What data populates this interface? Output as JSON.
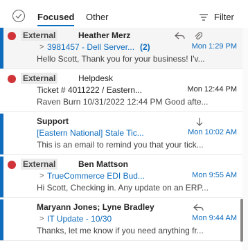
{
  "header": {
    "tabs": [
      {
        "label": "Focused",
        "active": true
      },
      {
        "label": "Other",
        "active": false
      }
    ],
    "filter_label": "Filter"
  },
  "colors": {
    "accent": "#0f6cbd",
    "external_dot": "#d13438"
  },
  "messages": [
    {
      "external_tag": "External",
      "sender": "Heather Merz",
      "subject": "3981457 - Dell Server...",
      "thread_count": "(2)",
      "time": "Mon 1:29 PM",
      "preview": "Hello Scott, Thank you for your business! I'v...",
      "icons": [
        "reply-icon",
        "attachment-icon"
      ]
    },
    {
      "external_tag": "External",
      "sender": "Helpdesk",
      "subject": "Ticket # 4011222 / Eastern...",
      "time": "Mon 12:44 PM",
      "preview": "Raven Burn 10/31/2022 12:44 PM Good afte..."
    },
    {
      "sender": "Support",
      "subject": "[Eastern National] Stale Tic...",
      "time": "Mon 10:02 AM",
      "preview": "This is an email to remind you that your tick...",
      "icons": [
        "low-importance-icon"
      ]
    },
    {
      "external_tag": "External",
      "sender": "Ben Mattson",
      "subject": "TrueCommerce EDI Bud...",
      "time": "Mon 9:55 AM",
      "preview": "Hi Scott, Checking in. Any update on an ERP..."
    },
    {
      "sender": "Maryann Jones; Lyne Bradley",
      "subject": "IT Update - 10/30",
      "time": "Mon 9:44 AM",
      "preview": "Thanks, let me know if you need anything fr...",
      "icons": [
        "reply-icon"
      ]
    }
  ]
}
